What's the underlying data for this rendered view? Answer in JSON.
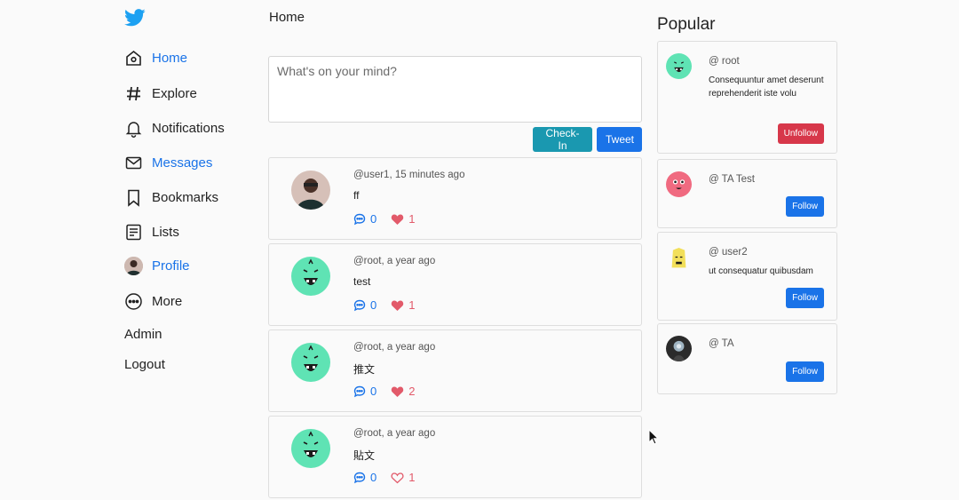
{
  "nav": {
    "logo_icon": "twitter-bird-icon",
    "items": [
      {
        "label": "Home",
        "icon": "home-icon",
        "active": true
      },
      {
        "label": "Explore",
        "icon": "hashtag-icon",
        "active": false
      },
      {
        "label": "Notifications",
        "icon": "bell-icon",
        "active": false
      },
      {
        "label": "Messages",
        "icon": "envelope-icon",
        "active": true
      },
      {
        "label": "Bookmarks",
        "icon": "bookmark-icon",
        "active": false
      },
      {
        "label": "Lists",
        "icon": "list-icon",
        "active": false
      },
      {
        "label": "Profile",
        "icon": "avatar",
        "active": true
      },
      {
        "label": "More",
        "icon": "more-icon",
        "active": false
      }
    ],
    "admin_label": "Admin",
    "logout_label": "Logout"
  },
  "main": {
    "title": "Home",
    "composer_placeholder": "What's on your mind?",
    "checkin_label": "Check-In",
    "tweet_label": "Tweet",
    "posts": [
      {
        "author": "@user1, 15 minutes ago",
        "text": "ff",
        "comments": "0",
        "likes": "1",
        "liked": true,
        "avatar": "photo"
      },
      {
        "author": "@root, a year ago",
        "text": "test",
        "comments": "0",
        "likes": "1",
        "liked": true,
        "avatar": "green-monster"
      },
      {
        "author": "@root, a year ago",
        "text": "推文",
        "comments": "0",
        "likes": "2",
        "liked": true,
        "avatar": "green-monster"
      },
      {
        "author": "@root, a year ago",
        "text": "貼文",
        "comments": "0",
        "likes": "1",
        "liked": false,
        "avatar": "green-monster"
      }
    ]
  },
  "popular": {
    "title": "Popular",
    "users": [
      {
        "handle": "@ root",
        "bio": "Consequuntur amet deserunt reprehenderit iste volu",
        "button": "Unfollow",
        "avatar": "green-monster"
      },
      {
        "handle": "@ TA Test",
        "bio": "",
        "button": "Follow",
        "avatar": "pink-monster"
      },
      {
        "handle": "@ user2",
        "bio": "ut consequatur quibusdam",
        "button": "Follow",
        "avatar": "yellow-monster"
      },
      {
        "handle": "@ TA",
        "bio": "",
        "button": "Follow",
        "avatar": "dark-photo"
      }
    ]
  },
  "colors": {
    "accent": "#1a73e8",
    "checkin": "#1a98b0",
    "unfollow": "#d7374a",
    "like": "#e25a6a",
    "monster_green": "#5fe3b4"
  }
}
